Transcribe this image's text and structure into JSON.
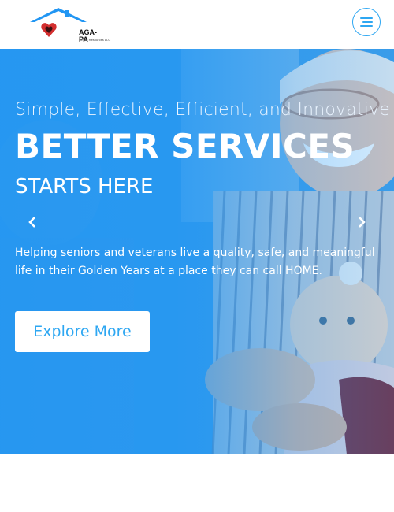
{
  "brand": {
    "name": "AGA-PA",
    "sub": "Senior Resources LLC",
    "colors": {
      "accent": "#2ea7f2",
      "roof": "#2196f3",
      "heart": "#d32f2f"
    }
  },
  "header": {
    "menu_icon": "hamburger-menu-icon"
  },
  "hero": {
    "tagline": "Simple, Effective, Efficient, and Innovative",
    "headline": "BETTER SERVICES",
    "subhead": "STARTS HERE",
    "description": "Helping seniors and veterans live a quality, safe, and meaningful life in their Golden Years at a place they can call HOME.",
    "cta_label": "Explore More",
    "prev_icon": "chevron-left-icon",
    "next_icon": "chevron-right-icon"
  }
}
